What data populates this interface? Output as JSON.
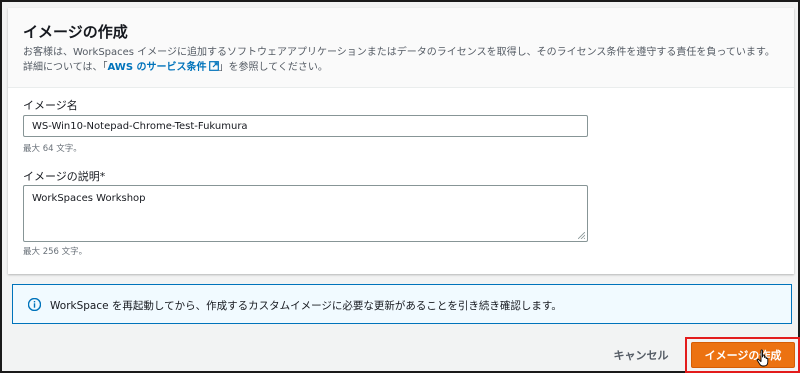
{
  "panel": {
    "title": "イメージの作成",
    "description_before_link": "お客様は、WorkSpaces イメージに追加するソフトウェアアプリケーションまたはデータのライセンスを取得し、そのライセンス条件を遵守する責任を負っています。詳細については、「",
    "link_text": "AWS のサービス条件",
    "description_after_link": "」を参照してください。",
    "link_icon": "external-link-icon"
  },
  "form": {
    "name_label": "イメージ名",
    "name_value": "WS-Win10-Notepad-Chrome-Test-Fukumura",
    "name_hint": "最大 64 文字。",
    "desc_label": "イメージの説明*",
    "desc_value": "WorkSpaces Workshop",
    "desc_hint": "最大 256 文字。"
  },
  "alert": {
    "icon": "info-icon",
    "text": "WorkSpace を再起動してから、作成するカスタムイメージに必要な更新があることを引き続き確認します。",
    "color": "#0073bb"
  },
  "actions": {
    "cancel_label": "キャンセル",
    "create_label": "イメージの作成",
    "primary_color": "#ec7211",
    "highlight_color": "#e31b1b"
  }
}
